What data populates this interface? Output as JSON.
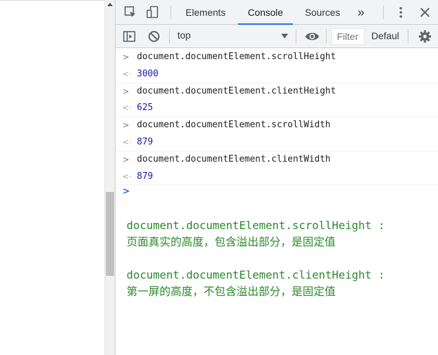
{
  "tabs": {
    "elements": "Elements",
    "console": "Console",
    "sources": "Sources",
    "more": "»"
  },
  "toolbar": {
    "context": "top",
    "filter_placeholder": "Filter",
    "levels": "Defaul"
  },
  "console": {
    "entries": [
      {
        "input": "document.documentElement.scrollHeight",
        "output": "3000"
      },
      {
        "input": "document.documentElement.clientHeight",
        "output": "625"
      },
      {
        "input": "document.documentElement.scrollWidth",
        "output": "879"
      },
      {
        "input": "document.documentElement.clientWidth",
        "output": "879"
      }
    ],
    "input_glyph": ">",
    "output_glyph": "<·",
    "prompt_glyph": ">"
  },
  "notes": [
    {
      "line1": "document.documentElement.scrollHeight :",
      "line2": "页面真实的高度，包含溢出部分，是固定值"
    },
    {
      "line1": "document.documentElement.clientHeight :",
      "line2": "第一屏的高度，不包含溢出部分，是固定值"
    }
  ],
  "colors": {
    "accent": "#1a73e8",
    "result_text": "#1a1aa6",
    "note_text": "#2b8a2b"
  }
}
